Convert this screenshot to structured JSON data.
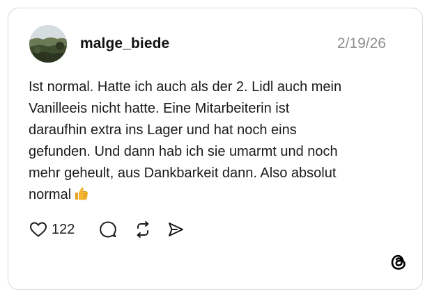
{
  "post": {
    "username": "malge_biede",
    "date": "2/19/26",
    "text_lines": [
      "Ist normal. Hatte ich auch als der 2. Lidl auch mein",
      "Vanilleeis nicht hatte. Eine Mitarbeiterin ist",
      "daraufhin extra ins Lager und hat noch eins",
      "gefunden. Und dann hab ich sie umarmt und noch",
      "mehr geheult, aus Dankbarkeit dann. Also absolut",
      "normal"
    ],
    "emoji": "thumbs-up",
    "like_count": "122"
  },
  "icons": {
    "avatar": "avatar-landscape",
    "like": "heart-icon",
    "reply": "comment-icon",
    "repost": "repost-icon",
    "share": "share-icon",
    "brand": "threads-logo-icon"
  },
  "colors": {
    "text": "#1a1a1a",
    "muted": "#8e8e8e",
    "border": "#d9d9d9",
    "emoji": "#f5b731"
  }
}
